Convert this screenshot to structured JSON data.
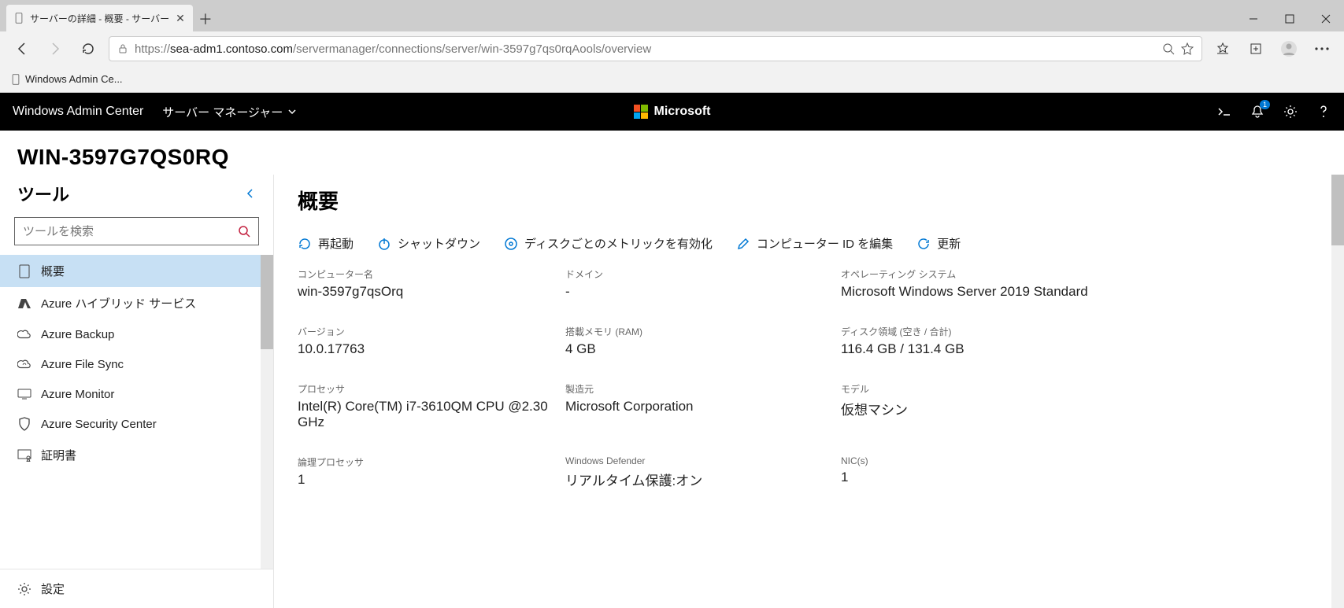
{
  "browser": {
    "tab_title": "サーバーの詳細 - 概要 - サーバー",
    "url_prefix": "https://",
    "url_host": "sea-adm1.contoso.com",
    "url_path": "/servermanager/connections/server/win-3597g7qs0rqAools/overview",
    "bookmark": "Windows Admin Ce..."
  },
  "header": {
    "product": "Windows Admin Center",
    "context_dropdown": "サーバー マネージャー",
    "ms_label": "Microsoft",
    "notification_count": "1"
  },
  "server_name": "WIN-3597G7QS0RQ",
  "sidebar": {
    "title": "ツール",
    "search_placeholder": "ツールを検索",
    "items": [
      {
        "label": "概要",
        "icon": "device"
      },
      {
        "label": "Azure ハイブリッド サービス",
        "icon": "azure"
      },
      {
        "label": "Azure Backup",
        "icon": "backup"
      },
      {
        "label": "Azure File Sync",
        "icon": "filesync"
      },
      {
        "label": "Azure Monitor",
        "icon": "monitor"
      },
      {
        "label": "Azure Security Center",
        "icon": "security"
      },
      {
        "label": "証明書",
        "icon": "certificate"
      }
    ],
    "footer_label": "設定"
  },
  "main": {
    "title": "概要",
    "commands": {
      "restart": "再起動",
      "shutdown": "シャットダウン",
      "disk_metrics": "ディスクごとのメトリックを有効化",
      "edit_id": "コンピューター ID を編集",
      "refresh": "更新"
    },
    "fields": {
      "computer_name": {
        "label": "コンピューター名",
        "value": "win-3597g7qsOrq"
      },
      "domain": {
        "label": "ドメイン",
        "value": "-"
      },
      "os": {
        "label": "オペレーティング システム",
        "value": "Microsoft Windows Server 2019 Standard"
      },
      "version": {
        "label": "バージョン",
        "value": "10.0.17763"
      },
      "ram": {
        "label": "搭載メモリ (RAM)",
        "value": "4 GB"
      },
      "disk": {
        "label": "ディスク領域 (空き / 合計)",
        "value": "116.4 GB / 131.4 GB"
      },
      "processor": {
        "label": "プロセッサ",
        "value": "Intel(R) Core(TM) i7-3610QM CPU @2.30 GHz"
      },
      "manufacturer": {
        "label": "製造元",
        "value": "Microsoft Corporation"
      },
      "model": {
        "label": "モデル",
        "value": "仮想マシン"
      },
      "logical_cpu": {
        "label": "論理プロセッサ",
        "value": "1"
      },
      "defender": {
        "label": "Windows Defender",
        "value": "リアルタイム保護:オン"
      },
      "nics": {
        "label": "NIC(s)",
        "value": "1"
      }
    }
  }
}
